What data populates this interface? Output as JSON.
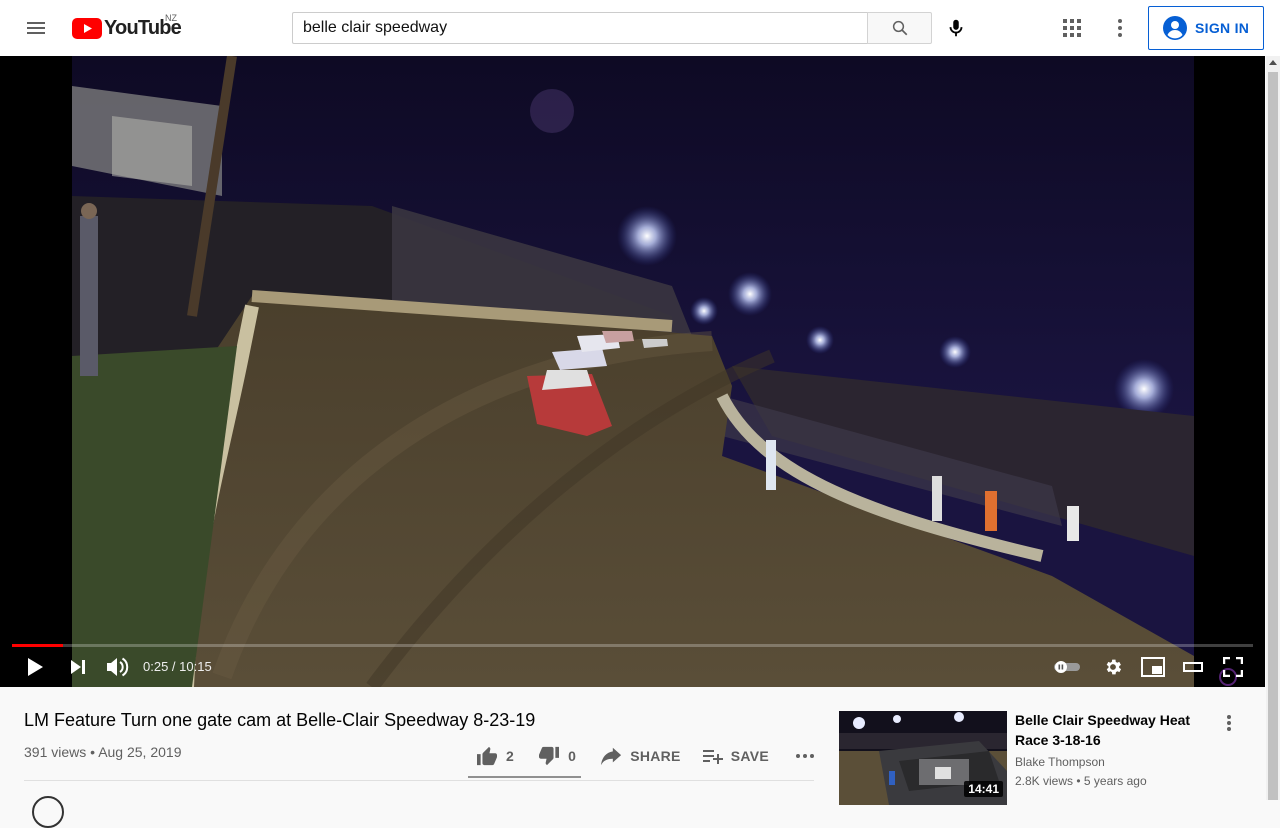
{
  "masthead": {
    "logo_text": "YouTube",
    "country_code": "NZ",
    "search_value": "belle clair speedway",
    "signin_label": "SIGN IN",
    "brand_red": "#ff0000",
    "accent_blue": "#065fd4"
  },
  "player": {
    "current_time": "0:25",
    "duration": "10:15",
    "time_separator": " / ",
    "progress": 0.041,
    "progress_color": "#ff0000",
    "icons": [
      "play-icon",
      "next-icon",
      "volume-icon",
      "autoplay-toggle-icon",
      "settings-icon",
      "miniplayer-icon",
      "theater-icon",
      "fullscreen-icon"
    ]
  },
  "video": {
    "title": "LM Feature Turn one gate cam at Belle-Clair Speedway 8-23-19",
    "views": "391 views",
    "dot": "•",
    "date": "Aug 25, 2019",
    "likes": "2",
    "dislikes": "0",
    "share_label": "SHARE",
    "save_label": "SAVE"
  },
  "related": [
    {
      "title": "Belle Clair Speedway Heat Race 3-18-16",
      "channel": "Blake Thompson",
      "views": "2.8K views",
      "age": "5 years ago",
      "duration": "14:41"
    }
  ]
}
